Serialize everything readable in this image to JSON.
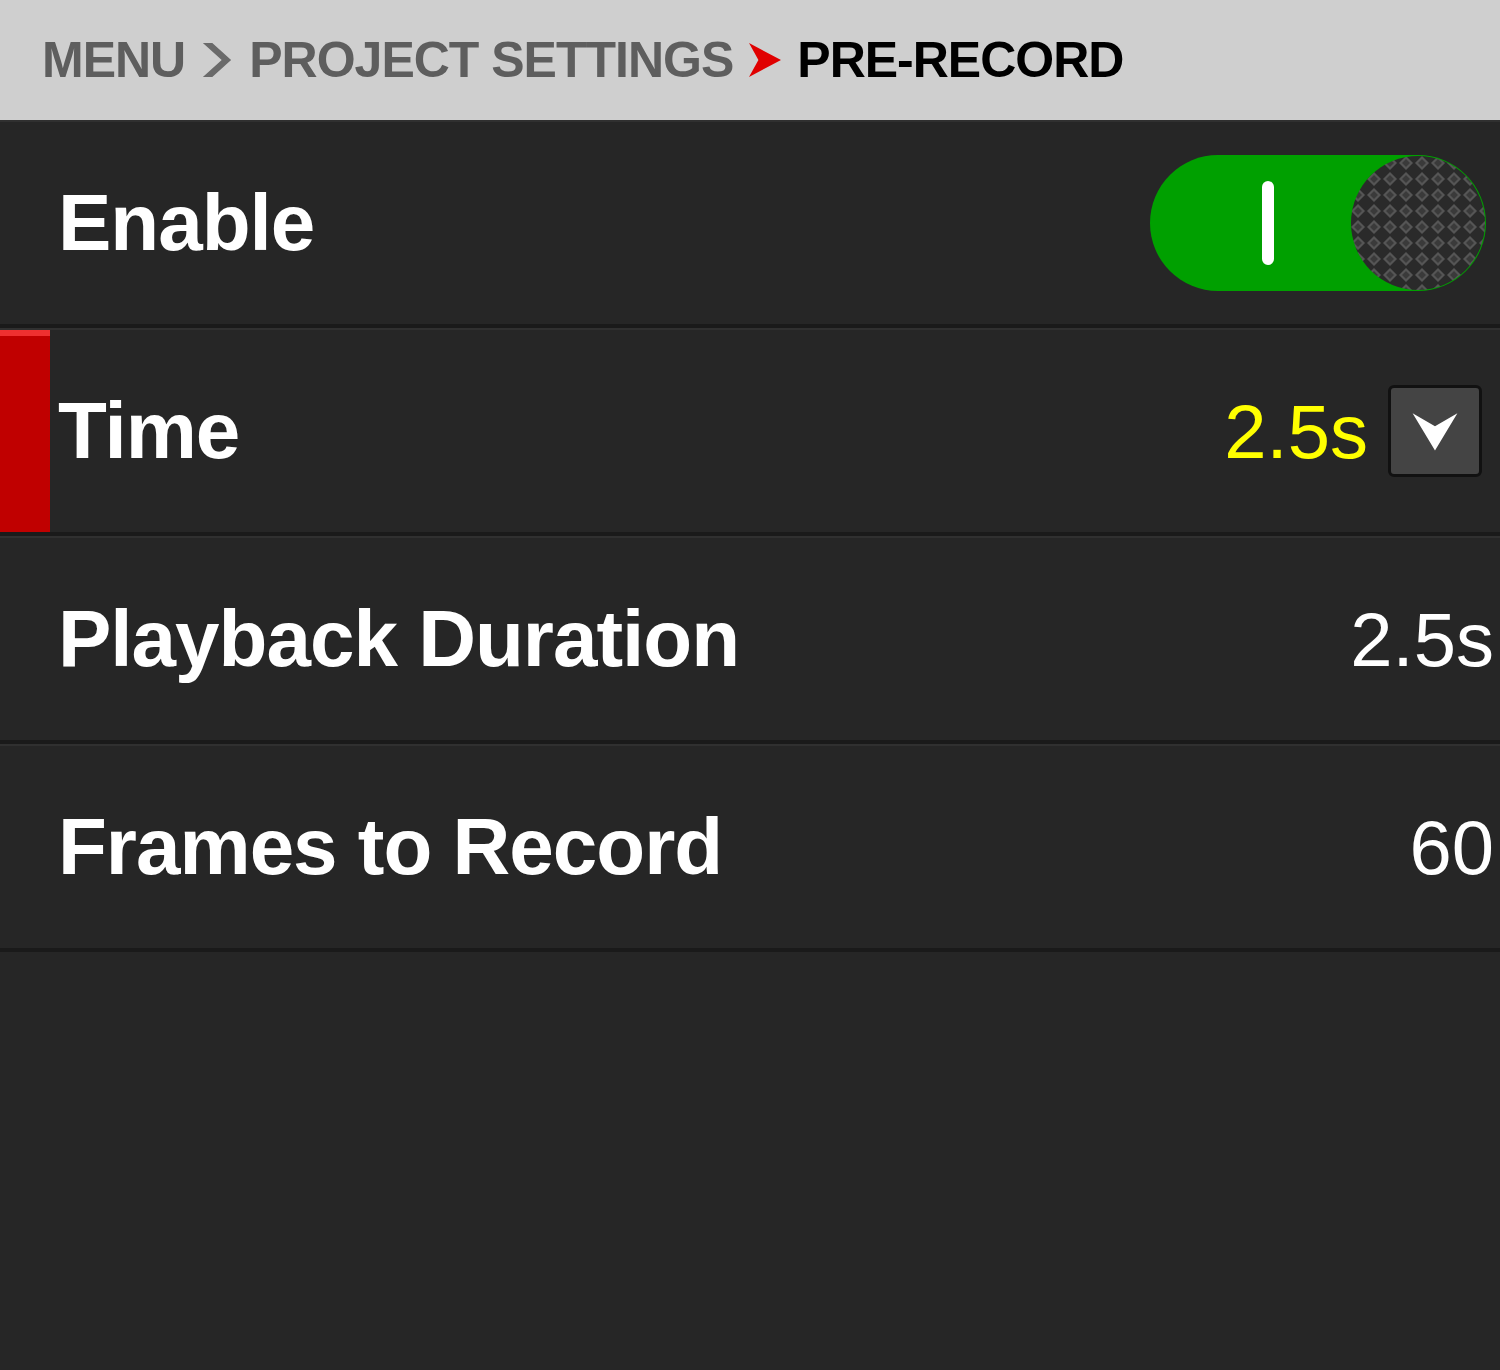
{
  "breadcrumb": [
    {
      "label": "MENU",
      "current": false
    },
    {
      "label": "PROJECT SETTINGS",
      "current": false
    },
    {
      "label": "PRE-RECORD",
      "current": true
    }
  ],
  "rows": [
    {
      "kind": "toggle",
      "label": "Enable",
      "selected": false,
      "on": true
    },
    {
      "kind": "dropdown",
      "label": "Time",
      "selected": true,
      "value": "2.5s"
    },
    {
      "kind": "value",
      "label": "Playback Duration",
      "selected": false,
      "value": "2.5s"
    },
    {
      "kind": "value",
      "label": "Frames to Record",
      "selected": false,
      "value": "60"
    }
  ]
}
